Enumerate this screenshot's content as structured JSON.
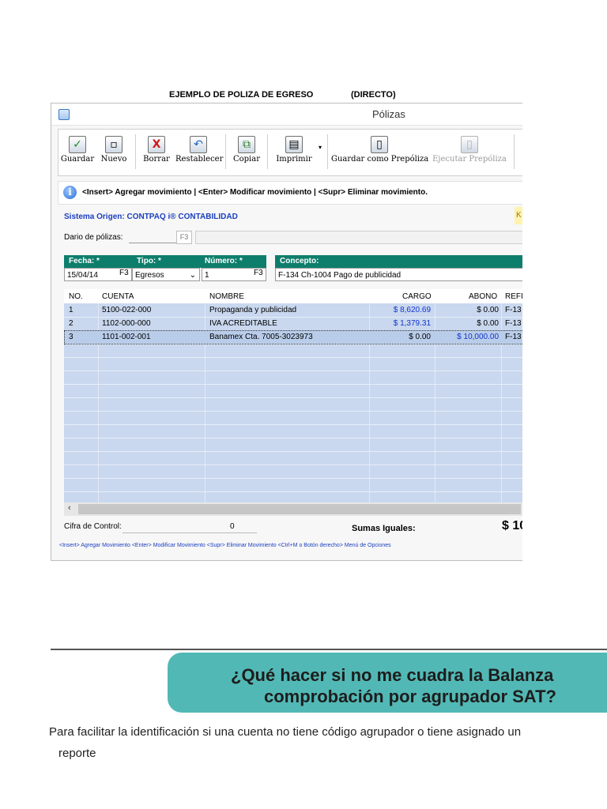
{
  "document": {
    "title": "EJEMPLO DE POLIZA DE EGRESO",
    "title_suffix": "(DIRECTO)"
  },
  "window": {
    "title": "Pólizas"
  },
  "toolbar": {
    "guardar": "Guardar",
    "nuevo": "Nuevo",
    "borrar": "Borrar",
    "restablecer": "Restablecer",
    "copiar": "Copiar",
    "imprimir": "Imprimir",
    "guardar_prepoliza": "Guardar como Prepóliza",
    "ejecutar_prepoliza": "Ejecutar Prepóliza"
  },
  "info": {
    "text": "<Insert> Agregar movimiento | <Enter> Modificar movimiento | <Supr> Eliminar movimiento."
  },
  "sistema_origen": "Sistema Origen: CONTPAQ i® CONTABILIDAD",
  "diario": {
    "label": "Dario de pólizas:",
    "f3": "F3"
  },
  "header_fields": {
    "fecha_label": "Fecha: *",
    "fecha_value": "15/04/14",
    "fecha_f3": "F3",
    "tipo_label": "Tipo: *",
    "tipo_value": "Egresos",
    "numero_label": "Número: *",
    "numero_value": "1",
    "numero_f3": "F3",
    "concepto_label": "Concepto:",
    "concepto_value": "F-134 Ch-1004 Pago de publicidad"
  },
  "grid": {
    "columns": {
      "no": "NO.",
      "cuenta": "CUENTA",
      "nombre": "NOMBRE",
      "cargo": "CARGO",
      "abono": "ABONO",
      "ref": "REFI"
    },
    "rows": [
      {
        "no": "1",
        "cuenta": "5100-022-000",
        "nombre": "Propaganda y publicidad",
        "cargo": "$ 8,620.69",
        "abono": "$ 0.00",
        "ref": "F-13"
      },
      {
        "no": "2",
        "cuenta": "1102-000-000",
        "nombre": "IVA ACREDITABLE",
        "cargo": "$ 1,379.31",
        "abono": "$ 0.00",
        "ref": "F-13"
      },
      {
        "no": "3",
        "cuenta": "1101-002-001",
        "nombre": "Banamex Cta. 7005-3023973",
        "cargo": "$ 0.00",
        "abono": "$ 10,000.00",
        "ref": "F-13"
      }
    ]
  },
  "footer": {
    "cifra_label": "Cifra de Control:",
    "cifra_value": "0",
    "sumas_label": "Sumas Iguales:",
    "sumas_value": "$ 10",
    "hint": "<Insert> Agregar Movimiento    <Enter> Modificar Movimiento    <Supr> Eliminar Movimiento    <Ctrl+M o Botón derecho> Menú de Opciones"
  },
  "banner": {
    "line1": "¿Qué hacer si no me cuadra la Balanza",
    "line2": "comprobación por agrupador SAT?"
  },
  "paragraph": {
    "line1": "Para facilitar la identificación si una cuenta no tiene código agrupador o tiene asignado un",
    "line2": "reporte"
  },
  "colors": {
    "header_teal": "#0e7e6c",
    "grid_blue": "#c9d8ef",
    "banner": "#52b8b5",
    "link_blue": "#1233cc"
  }
}
